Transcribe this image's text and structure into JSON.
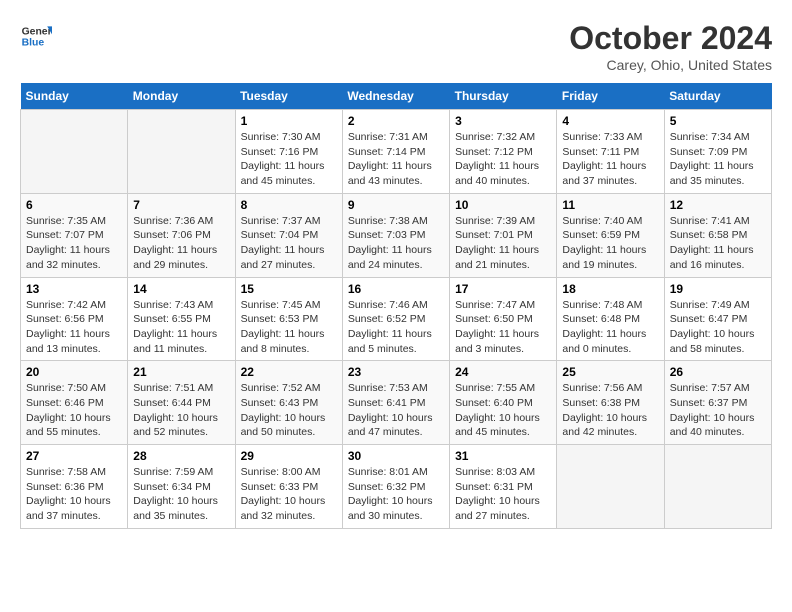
{
  "header": {
    "logo_line1": "General",
    "logo_line2": "Blue",
    "month": "October 2024",
    "location": "Carey, Ohio, United States"
  },
  "weekdays": [
    "Sunday",
    "Monday",
    "Tuesday",
    "Wednesday",
    "Thursday",
    "Friday",
    "Saturday"
  ],
  "weeks": [
    [
      {
        "day": "",
        "sunrise": "",
        "sunset": "",
        "daylight": ""
      },
      {
        "day": "",
        "sunrise": "",
        "sunset": "",
        "daylight": ""
      },
      {
        "day": "1",
        "sunrise": "Sunrise: 7:30 AM",
        "sunset": "Sunset: 7:16 PM",
        "daylight": "Daylight: 11 hours and 45 minutes."
      },
      {
        "day": "2",
        "sunrise": "Sunrise: 7:31 AM",
        "sunset": "Sunset: 7:14 PM",
        "daylight": "Daylight: 11 hours and 43 minutes."
      },
      {
        "day": "3",
        "sunrise": "Sunrise: 7:32 AM",
        "sunset": "Sunset: 7:12 PM",
        "daylight": "Daylight: 11 hours and 40 minutes."
      },
      {
        "day": "4",
        "sunrise": "Sunrise: 7:33 AM",
        "sunset": "Sunset: 7:11 PM",
        "daylight": "Daylight: 11 hours and 37 minutes."
      },
      {
        "day": "5",
        "sunrise": "Sunrise: 7:34 AM",
        "sunset": "Sunset: 7:09 PM",
        "daylight": "Daylight: 11 hours and 35 minutes."
      }
    ],
    [
      {
        "day": "6",
        "sunrise": "Sunrise: 7:35 AM",
        "sunset": "Sunset: 7:07 PM",
        "daylight": "Daylight: 11 hours and 32 minutes."
      },
      {
        "day": "7",
        "sunrise": "Sunrise: 7:36 AM",
        "sunset": "Sunset: 7:06 PM",
        "daylight": "Daylight: 11 hours and 29 minutes."
      },
      {
        "day": "8",
        "sunrise": "Sunrise: 7:37 AM",
        "sunset": "Sunset: 7:04 PM",
        "daylight": "Daylight: 11 hours and 27 minutes."
      },
      {
        "day": "9",
        "sunrise": "Sunrise: 7:38 AM",
        "sunset": "Sunset: 7:03 PM",
        "daylight": "Daylight: 11 hours and 24 minutes."
      },
      {
        "day": "10",
        "sunrise": "Sunrise: 7:39 AM",
        "sunset": "Sunset: 7:01 PM",
        "daylight": "Daylight: 11 hours and 21 minutes."
      },
      {
        "day": "11",
        "sunrise": "Sunrise: 7:40 AM",
        "sunset": "Sunset: 6:59 PM",
        "daylight": "Daylight: 11 hours and 19 minutes."
      },
      {
        "day": "12",
        "sunrise": "Sunrise: 7:41 AM",
        "sunset": "Sunset: 6:58 PM",
        "daylight": "Daylight: 11 hours and 16 minutes."
      }
    ],
    [
      {
        "day": "13",
        "sunrise": "Sunrise: 7:42 AM",
        "sunset": "Sunset: 6:56 PM",
        "daylight": "Daylight: 11 hours and 13 minutes."
      },
      {
        "day": "14",
        "sunrise": "Sunrise: 7:43 AM",
        "sunset": "Sunset: 6:55 PM",
        "daylight": "Daylight: 11 hours and 11 minutes."
      },
      {
        "day": "15",
        "sunrise": "Sunrise: 7:45 AM",
        "sunset": "Sunset: 6:53 PM",
        "daylight": "Daylight: 11 hours and 8 minutes."
      },
      {
        "day": "16",
        "sunrise": "Sunrise: 7:46 AM",
        "sunset": "Sunset: 6:52 PM",
        "daylight": "Daylight: 11 hours and 5 minutes."
      },
      {
        "day": "17",
        "sunrise": "Sunrise: 7:47 AM",
        "sunset": "Sunset: 6:50 PM",
        "daylight": "Daylight: 11 hours and 3 minutes."
      },
      {
        "day": "18",
        "sunrise": "Sunrise: 7:48 AM",
        "sunset": "Sunset: 6:48 PM",
        "daylight": "Daylight: 11 hours and 0 minutes."
      },
      {
        "day": "19",
        "sunrise": "Sunrise: 7:49 AM",
        "sunset": "Sunset: 6:47 PM",
        "daylight": "Daylight: 10 hours and 58 minutes."
      }
    ],
    [
      {
        "day": "20",
        "sunrise": "Sunrise: 7:50 AM",
        "sunset": "Sunset: 6:46 PM",
        "daylight": "Daylight: 10 hours and 55 minutes."
      },
      {
        "day": "21",
        "sunrise": "Sunrise: 7:51 AM",
        "sunset": "Sunset: 6:44 PM",
        "daylight": "Daylight: 10 hours and 52 minutes."
      },
      {
        "day": "22",
        "sunrise": "Sunrise: 7:52 AM",
        "sunset": "Sunset: 6:43 PM",
        "daylight": "Daylight: 10 hours and 50 minutes."
      },
      {
        "day": "23",
        "sunrise": "Sunrise: 7:53 AM",
        "sunset": "Sunset: 6:41 PM",
        "daylight": "Daylight: 10 hours and 47 minutes."
      },
      {
        "day": "24",
        "sunrise": "Sunrise: 7:55 AM",
        "sunset": "Sunset: 6:40 PM",
        "daylight": "Daylight: 10 hours and 45 minutes."
      },
      {
        "day": "25",
        "sunrise": "Sunrise: 7:56 AM",
        "sunset": "Sunset: 6:38 PM",
        "daylight": "Daylight: 10 hours and 42 minutes."
      },
      {
        "day": "26",
        "sunrise": "Sunrise: 7:57 AM",
        "sunset": "Sunset: 6:37 PM",
        "daylight": "Daylight: 10 hours and 40 minutes."
      }
    ],
    [
      {
        "day": "27",
        "sunrise": "Sunrise: 7:58 AM",
        "sunset": "Sunset: 6:36 PM",
        "daylight": "Daylight: 10 hours and 37 minutes."
      },
      {
        "day": "28",
        "sunrise": "Sunrise: 7:59 AM",
        "sunset": "Sunset: 6:34 PM",
        "daylight": "Daylight: 10 hours and 35 minutes."
      },
      {
        "day": "29",
        "sunrise": "Sunrise: 8:00 AM",
        "sunset": "Sunset: 6:33 PM",
        "daylight": "Daylight: 10 hours and 32 minutes."
      },
      {
        "day": "30",
        "sunrise": "Sunrise: 8:01 AM",
        "sunset": "Sunset: 6:32 PM",
        "daylight": "Daylight: 10 hours and 30 minutes."
      },
      {
        "day": "31",
        "sunrise": "Sunrise: 8:03 AM",
        "sunset": "Sunset: 6:31 PM",
        "daylight": "Daylight: 10 hours and 27 minutes."
      },
      {
        "day": "",
        "sunrise": "",
        "sunset": "",
        "daylight": ""
      },
      {
        "day": "",
        "sunrise": "",
        "sunset": "",
        "daylight": ""
      }
    ]
  ]
}
